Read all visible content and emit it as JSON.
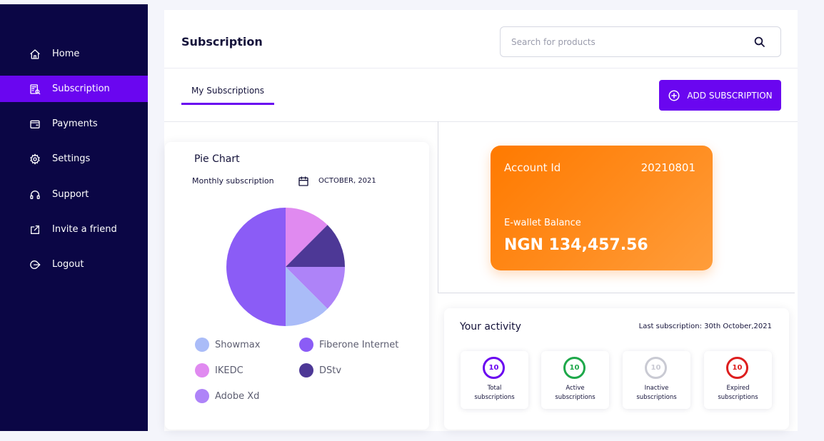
{
  "sidebar": {
    "items": [
      {
        "label": "Home",
        "icon": "home-icon",
        "active": false
      },
      {
        "label": "Subscription",
        "icon": "subscription-icon",
        "active": true
      },
      {
        "label": "Payments",
        "icon": "wallet-icon",
        "active": false
      },
      {
        "label": "Settings",
        "icon": "gear-icon",
        "active": false
      },
      {
        "label": "Support",
        "icon": "headset-icon",
        "active": false
      },
      {
        "label": "Invite a friend",
        "icon": "share-icon",
        "active": false
      },
      {
        "label": "Logout",
        "icon": "logout-icon",
        "active": false
      }
    ]
  },
  "header": {
    "title": "Subscription",
    "search_placeholder": "Search for products"
  },
  "tabs": {
    "active_label": "My Subscriptions"
  },
  "actions": {
    "add_label": "ADD SUBSCRIPTION"
  },
  "pie_card": {
    "title": "Pie Chart",
    "subtitle": "Monthly subscription",
    "date": "OCTOBER, 2021"
  },
  "chart_data": {
    "type": "pie",
    "title": "Pie Chart",
    "slices": [
      {
        "label": "IKEDC",
        "value": 12.5,
        "color": "#e08af0"
      },
      {
        "label": "DStv",
        "value": 12.5,
        "color": "#4d3896"
      },
      {
        "label": "Adobe Xd",
        "value": 12.5,
        "color": "#ae83f8"
      },
      {
        "label": "Showmax",
        "value": 12.5,
        "color": "#aabcf8"
      },
      {
        "label": "Fiberone Internet",
        "value": 50,
        "color": "#8b5cf6"
      }
    ],
    "legend": [
      {
        "label": "Showmax",
        "color": "#aabcf8"
      },
      {
        "label": "Fiberone Internet",
        "color": "#8b5cf6"
      },
      {
        "label": "IKEDC",
        "color": "#e08af0"
      },
      {
        "label": "DStv",
        "color": "#4d3896"
      },
      {
        "label": "Adobe Xd",
        "color": "#ae83f8"
      }
    ]
  },
  "account": {
    "id_label": "Account Id",
    "id_value": "20210801",
    "wallet_label": "E-wallet Balance",
    "wallet_balance": "NGN 134,457.56"
  },
  "activity": {
    "title": "Your activity",
    "last_subscription": "Last subscription: 30th October,2021",
    "stats": [
      {
        "count": "10",
        "label1": "Total",
        "label2": "subscriptions",
        "color": "#6a06f0"
      },
      {
        "count": "10",
        "label1": "Active",
        "label2": "subscriptions",
        "color": "#1ea84a"
      },
      {
        "count": "10",
        "label1": "Inactive",
        "label2": "subscriptions",
        "color": "#c9cad3"
      },
      {
        "count": "10",
        "label1": "Expired",
        "label2": "subscriptions",
        "color": "#dd1e1e"
      }
    ]
  },
  "colors": {
    "sidebar_bg": "#0b0645",
    "accent": "#6a06f0",
    "card_orange": "#ff7a00"
  }
}
